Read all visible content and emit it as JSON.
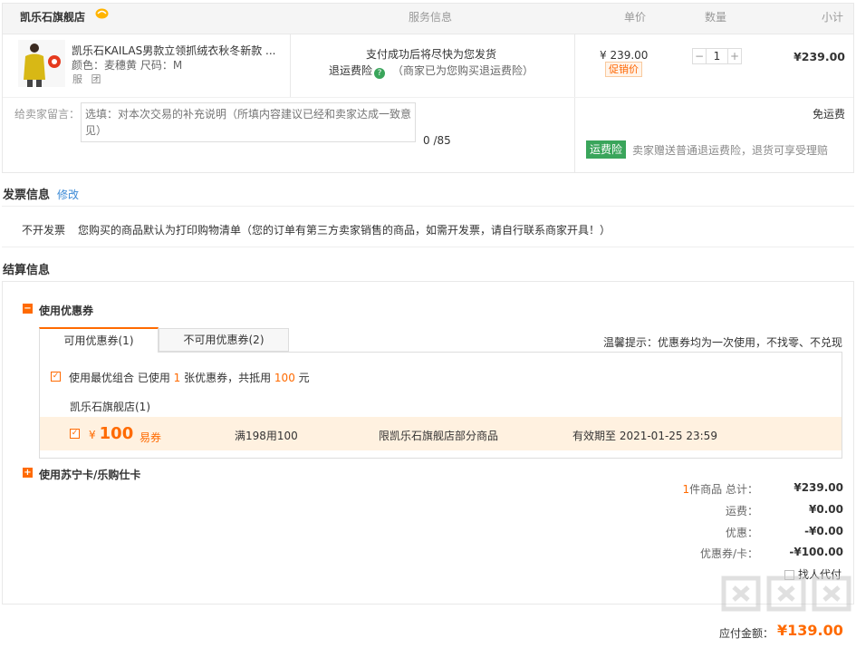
{
  "order": {
    "shop_name": "凯乐石旗舰店",
    "columns": {
      "service": "服务信息",
      "price": "单价",
      "quantity": "数量",
      "subtotal": "小计"
    },
    "product": {
      "title": "凯乐石KAILAS男款立领抓绒衣秋冬新款 ...",
      "attrs": "颜色：麦穗黄   尺码：M",
      "tags": "服 团",
      "service_line1": "支付成功后将尽快为您发货",
      "service_insurance": "退运费险",
      "service_insurance_note": "（商家已为您购买退运费险）",
      "price": "¥ 239.00",
      "promo_tag": "促销价",
      "quantity": "1",
      "subtotal": "¥239.00"
    },
    "message": {
      "label": "给卖家留言：",
      "placeholder": "选填：对本次交易的补充说明（所填内容建议已经和卖家达成一致意见）",
      "count": "0 /85"
    },
    "shipping": {
      "fee": "免运费",
      "insurance_badge": "运费险",
      "insurance_text": "卖家赠送普通退运费险，退货可享受理赔"
    }
  },
  "invoice": {
    "title": "发票信息",
    "edit_link": "修改",
    "type": "不开发票",
    "desc": "您购买的商品默认为打印购物清单（您的订单有第三方卖家销售的商品，如需开发票，请自行联系商家开具！）"
  },
  "settlement": {
    "title": "结算信息",
    "coupon_section": "使用优惠券",
    "tabs": [
      "可用优惠券(1)",
      "不可用优惠券(2)"
    ],
    "tip": "温馨提示：优惠券均为一次使用，不找零、不兑现",
    "best_combo_prefix": "使用最优组合   已使用 ",
    "best_combo_count": "1",
    "best_combo_mid": " 张优惠券，共抵用 ",
    "best_combo_amount": "100",
    "best_combo_suffix": " 元",
    "shop_group": "凯乐石旗舰店(1)",
    "coupon": {
      "currency": "¥",
      "amount": "100",
      "kind": "易券",
      "rule": "满198用100",
      "scope": "限凯乐石旗舰店部分商品",
      "expire": "有效期至  2021-01-25 23:59"
    },
    "card_section": "使用苏宁卡/乐购仕卡",
    "summary": {
      "count": "1",
      "count_suffix": "件商品  总计：",
      "total": "¥239.00",
      "shipping_label": "运费：",
      "shipping": "¥0.00",
      "discount_label": "优惠：",
      "discount": "-¥0.00",
      "coupon_label": "优惠券/卡：",
      "coupon": "-¥100.00"
    },
    "proxy_pay": "找人代付",
    "payable_label": "应付金额：",
    "payable": "¥139.00"
  },
  "colors": {
    "accent": "#ff6a00",
    "link": "#3c8ad6",
    "green": "#3aa55b"
  },
  "icons": [
    "shop-badge-icon",
    "question-icon",
    "collapse-icon",
    "expand-icon",
    "checkbox-checked-icon"
  ]
}
